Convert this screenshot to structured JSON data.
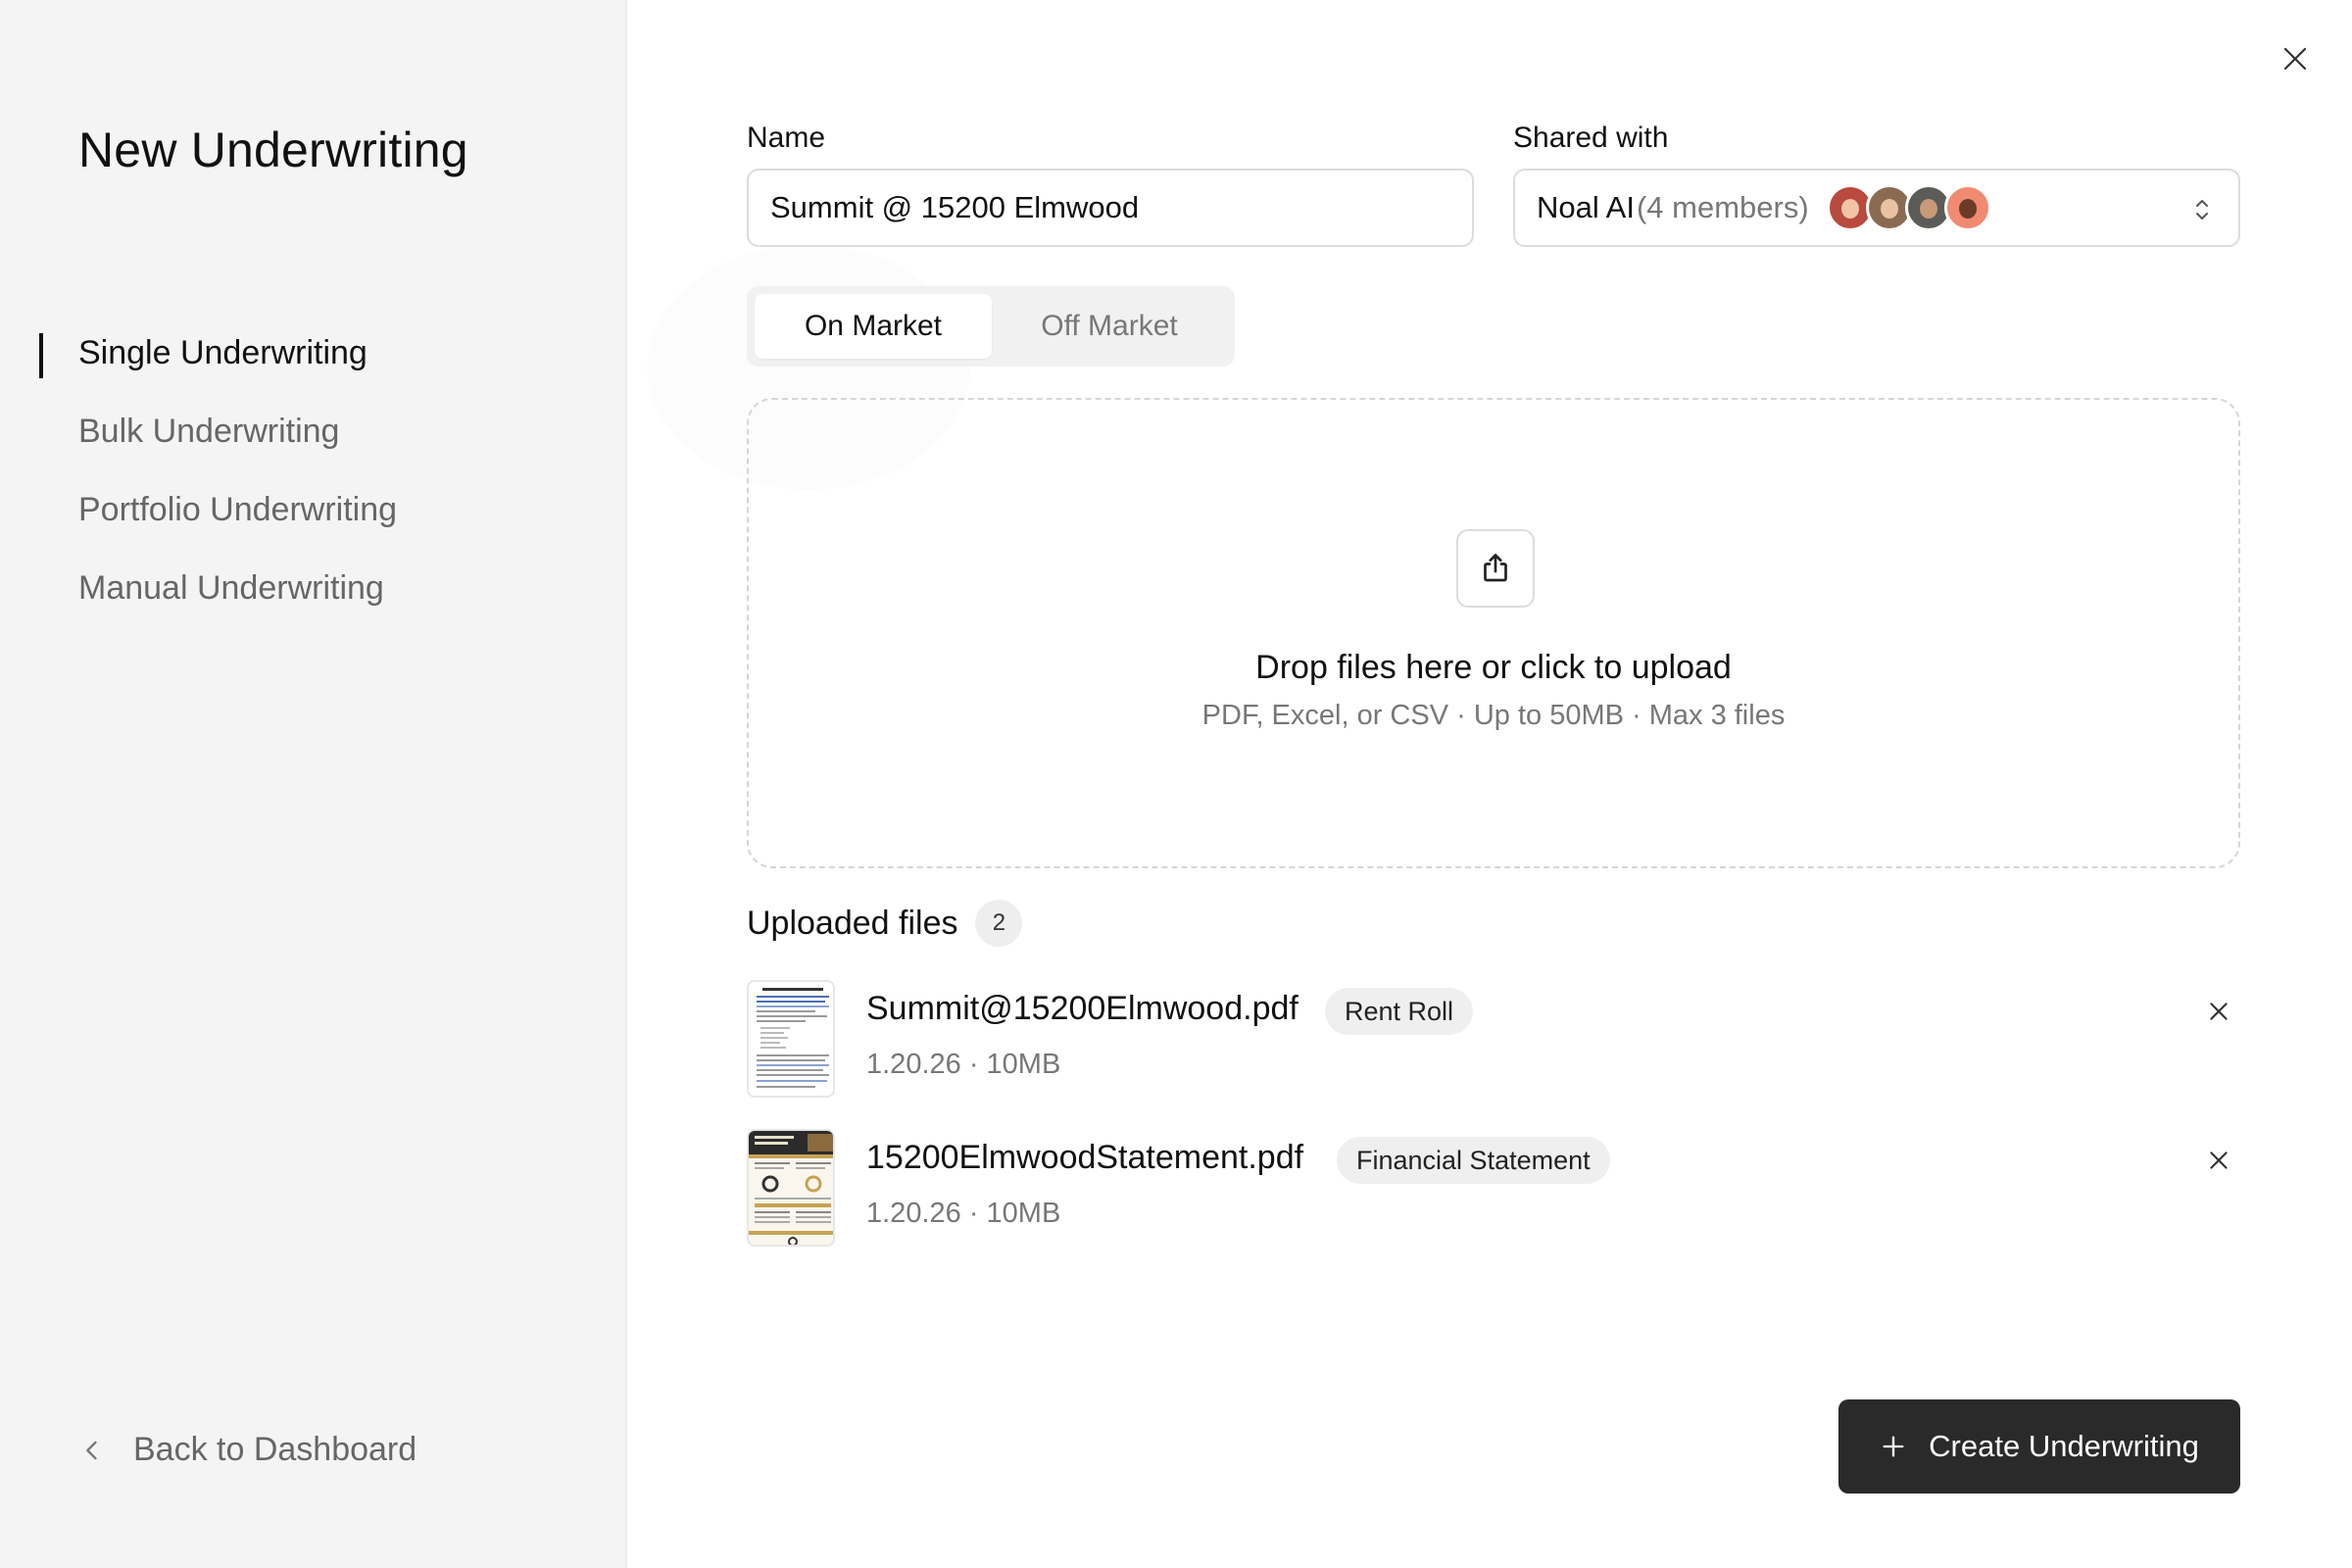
{
  "sidebar": {
    "title": "New Underwriting",
    "items": [
      {
        "label": "Single Underwriting",
        "active": true
      },
      {
        "label": "Bulk Underwriting",
        "active": false
      },
      {
        "label": "Portfolio Underwriting",
        "active": false
      },
      {
        "label": "Manual Underwriting",
        "active": false
      }
    ],
    "back_label": "Back to Dashboard"
  },
  "form": {
    "name_label": "Name",
    "name_value": "Summit @ 15200 Elmwood",
    "shared_label": "Shared with",
    "shared_team": "Noal AI",
    "shared_count": "(4 members)",
    "avatars": [
      {
        "name": "avatar-1",
        "bg": "#b84a3e",
        "skin": "#f1c4a6"
      },
      {
        "name": "avatar-2",
        "bg": "#8a6a52",
        "skin": "#e9c2a3"
      },
      {
        "name": "avatar-3",
        "bg": "#5b5b58",
        "skin": "#c79a78"
      },
      {
        "name": "avatar-4",
        "bg": "#f08a70",
        "skin": "#6b3b26"
      }
    ]
  },
  "market_toggle": {
    "options": [
      "On Market",
      "Off Market"
    ],
    "selected": "On Market"
  },
  "dropzone": {
    "title": "Drop files here or click to upload",
    "subtitle": "PDF, Excel, or CSV · Up to 50MB · Max 3 files"
  },
  "uploaded": {
    "title": "Uploaded files",
    "count": "2",
    "files": [
      {
        "name": "Summit@15200Elmwood.pdf",
        "tag": "Rent Roll",
        "meta": "1.20.26 · 10MB"
      },
      {
        "name": "15200ElmwoodStatement.pdf",
        "tag": "Financial Statement",
        "meta": "1.20.26 · 10MB"
      }
    ]
  },
  "actions": {
    "create_label": "Create Underwriting"
  },
  "colors": {
    "primary_button": "#2a2a2a",
    "sidebar_bg": "#f4f4f4",
    "muted_text": "#777777"
  },
  "icons": {
    "close": "close-icon",
    "back": "chevron-left-icon",
    "upload": "upload-icon",
    "sort": "chevron-up-down-icon",
    "plus": "plus-icon"
  }
}
